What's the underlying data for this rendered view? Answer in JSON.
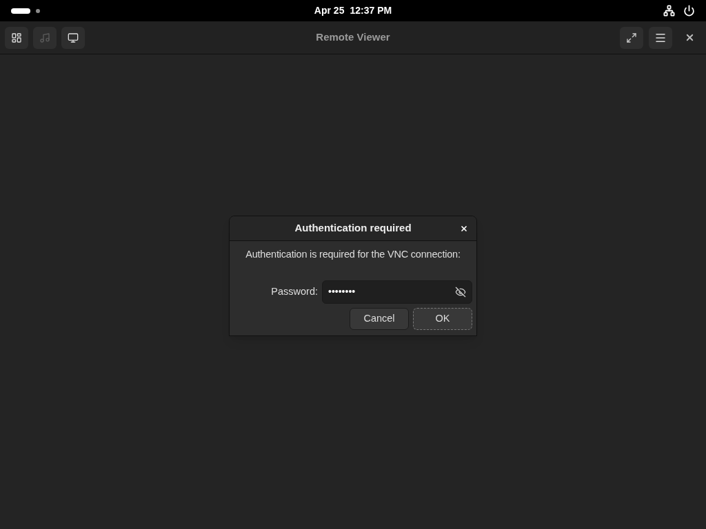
{
  "top_bar": {
    "workspaces": [
      {
        "selected": true
      },
      {
        "selected": false
      }
    ],
    "date": "Apr 25",
    "time": "12:37 PM"
  },
  "window": {
    "title": "Remote Viewer",
    "toolbar": [
      {
        "kind": "overview",
        "disabled": false
      },
      {
        "kind": "media",
        "disabled": true
      },
      {
        "kind": "display",
        "disabled": false
      }
    ]
  },
  "dialog": {
    "title": "Authentication required",
    "message": "Authentication is required for the VNC connection:",
    "password": {
      "label": "Password:",
      "value": "••••••••"
    },
    "buttons": [
      {
        "label": "Cancel",
        "focused": false
      },
      {
        "label": "OK",
        "focused": true
      }
    ]
  }
}
